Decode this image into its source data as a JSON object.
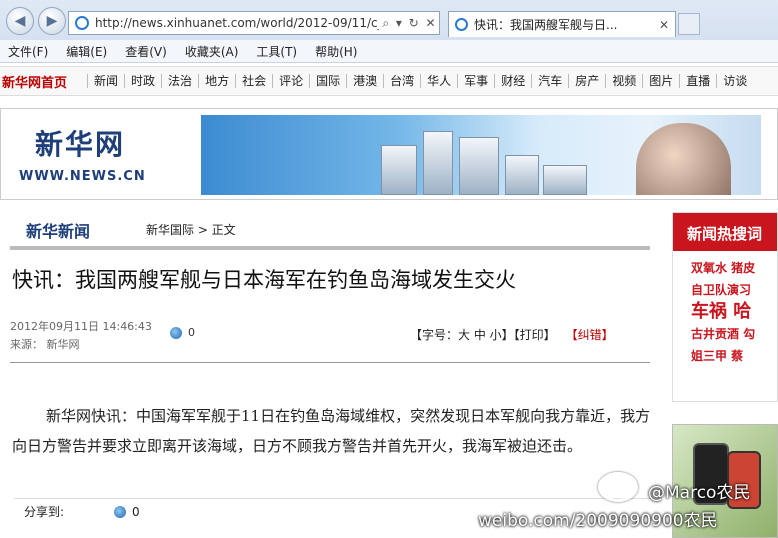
{
  "browser": {
    "url": "http://news.xinhuanet.com/world/2012-09/11/c_1",
    "tab_title": "快讯：我国两艘军舰与日..."
  },
  "menu": [
    "文件(F)",
    "编辑(E)",
    "查看(V)",
    "收藏夹(A)",
    "工具(T)",
    "帮助(H)"
  ],
  "site_nav": {
    "home": "新华网首页",
    "items": [
      "新闻",
      "时政",
      "法治",
      "地方",
      "社会",
      "评论",
      "国际",
      "港澳",
      "台湾",
      "华人",
      "军事",
      "财经",
      "汽车",
      "房产",
      "视频",
      "图片",
      "直播",
      "访谈"
    ]
  },
  "logo": {
    "cn": "新华网",
    "en": "WWW.NEWS.CN"
  },
  "article": {
    "brand": "新华新闻",
    "breadcrumb": "新华国际 > 正文",
    "title": "快讯：我国两艘军舰与日本海军在钓鱼岛海域发生交火",
    "date": "2012年09月11日 14:46:43",
    "source": "来源： 新华网",
    "views": "0",
    "tools": "【字号：大 中 小】【打印】",
    "error": "【纠错】",
    "body": "新华网快讯：中国海军军舰于11日在钓鱼岛海域维权，突然发现日本军舰向我方靠近，我方向日方警告并要求立即离开该海域，日方不顾我方警告并首先开火，我海军被迫还击。",
    "share_label": "分享到:",
    "share_count": "0"
  },
  "sidebar": {
    "head": "新闻热搜词",
    "row1": "双氧水 猪皮",
    "row2": "自卫队演习",
    "row3": "车祸 哈",
    "row4": "古井贡酒 勾",
    "row5": "姐三甲 蔡"
  },
  "watermark": {
    "user": "@Marco农民",
    "site": "weibo.com/2009090900农民"
  }
}
